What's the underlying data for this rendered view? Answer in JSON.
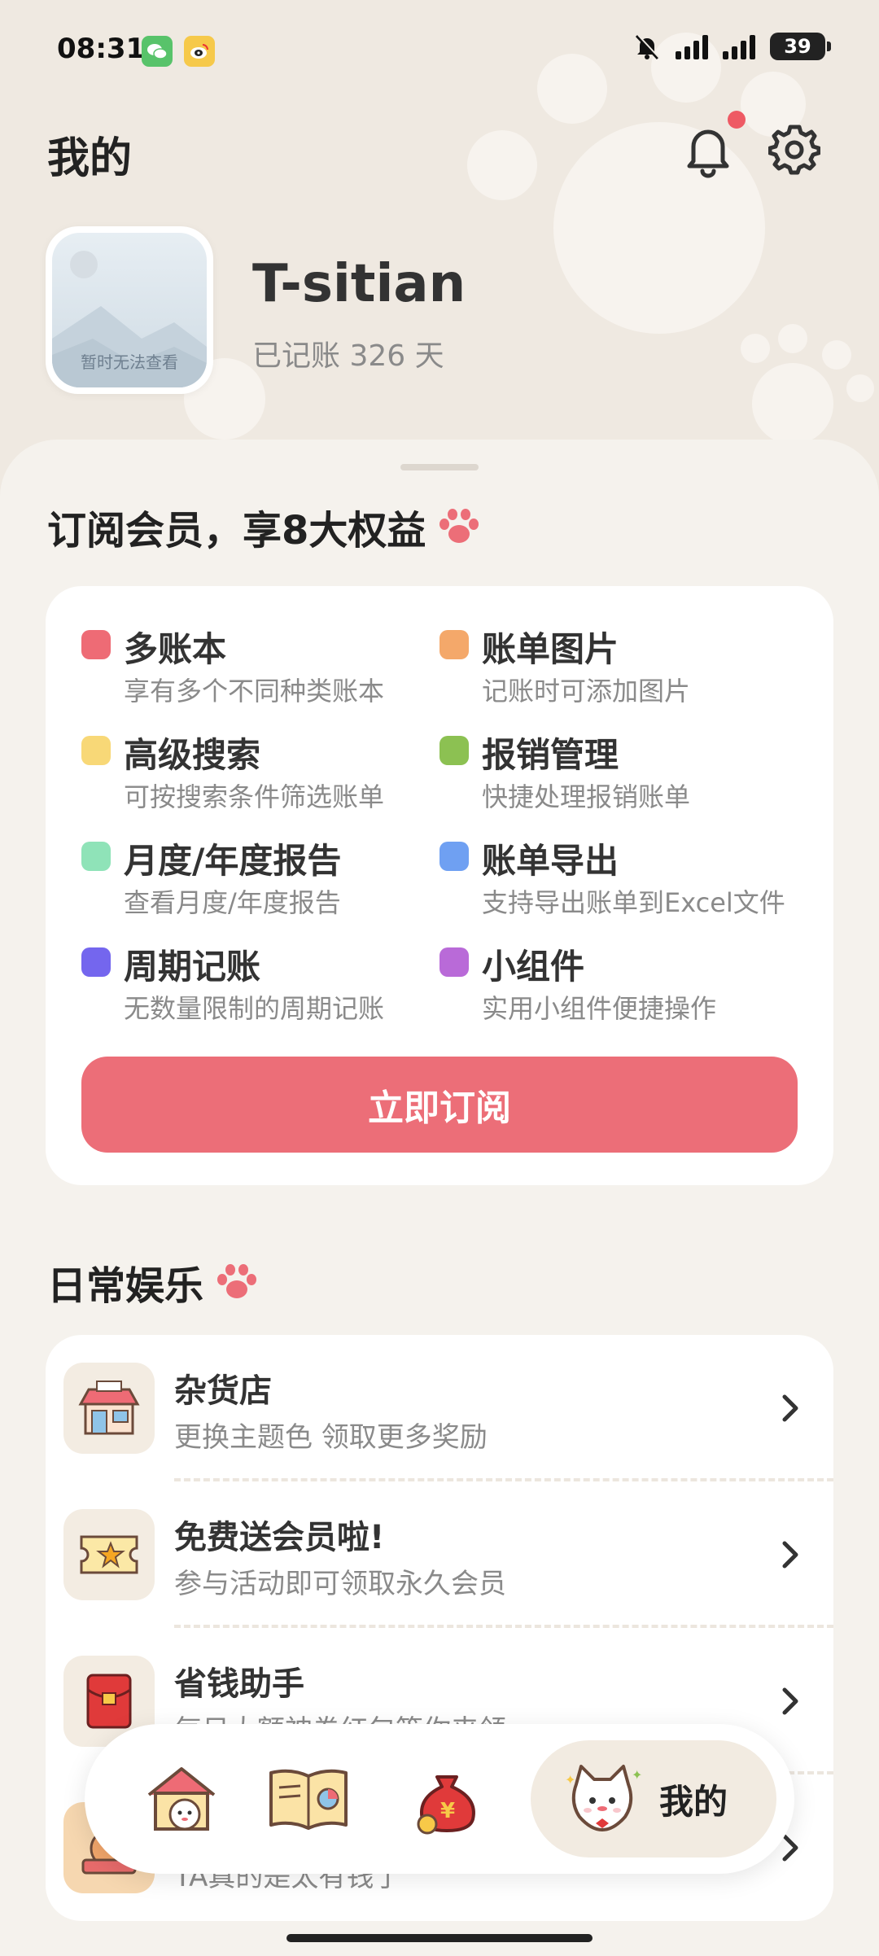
{
  "status_bar": {
    "time": "08:31",
    "battery": "39",
    "apps": [
      "wechat-icon",
      "weibo-icon"
    ]
  },
  "header": {
    "title": "我的"
  },
  "profile": {
    "avatar_caption": "暂时无法查看",
    "username": "T-sitian",
    "days_label": "已记账 326 天"
  },
  "membership": {
    "title": "订阅会员，享8大权益",
    "benefits": [
      {
        "title": "多账本",
        "desc": "享有多个不同种类账本",
        "color": "#ee6b75"
      },
      {
        "title": "账单图片",
        "desc": "记账时可添加图片",
        "color": "#f4a86a"
      },
      {
        "title": "高级搜索",
        "desc": "可按搜索条件筛选账单",
        "color": "#f8d877"
      },
      {
        "title": "报销管理",
        "desc": "快捷处理报销账单",
        "color": "#8cc152"
      },
      {
        "title": "月度/年度报告",
        "desc": "查看月度/年度报告",
        "color": "#8fe3b8"
      },
      {
        "title": "账单导出",
        "desc": "支持导出账单到Excel文件",
        "color": "#6fa0f2"
      },
      {
        "title": "周期记账",
        "desc": "无数量限制的周期记账",
        "color": "#7466ee"
      },
      {
        "title": "小组件",
        "desc": "实用小组件便捷操作",
        "color": "#b96ad8"
      }
    ],
    "subscribe_label": "立即订阅"
  },
  "entertainment": {
    "title": "日常娱乐",
    "items": [
      {
        "title": "杂货店",
        "desc": "更换主题色 领取更多奖励",
        "icon": "shop-icon"
      },
      {
        "title": "免费送会员啦!",
        "desc": "参与活动即可领取永久会员",
        "icon": "ticket-icon"
      },
      {
        "title": "省钱助手",
        "desc": "每日大额神券红包等你来领",
        "icon": "red-envelope-icon"
      },
      {
        "title": "",
        "desc": "TA真的是太有钱了",
        "icon": "rich-icon"
      }
    ]
  },
  "bottom_nav": {
    "items": [
      "home-icon",
      "ledger-book-icon",
      "money-bag-icon"
    ],
    "active_label": "我的"
  },
  "colors": {
    "accent": "#ec6e78",
    "background": "#f3efe8",
    "notification_dot": "#ee5a64"
  }
}
